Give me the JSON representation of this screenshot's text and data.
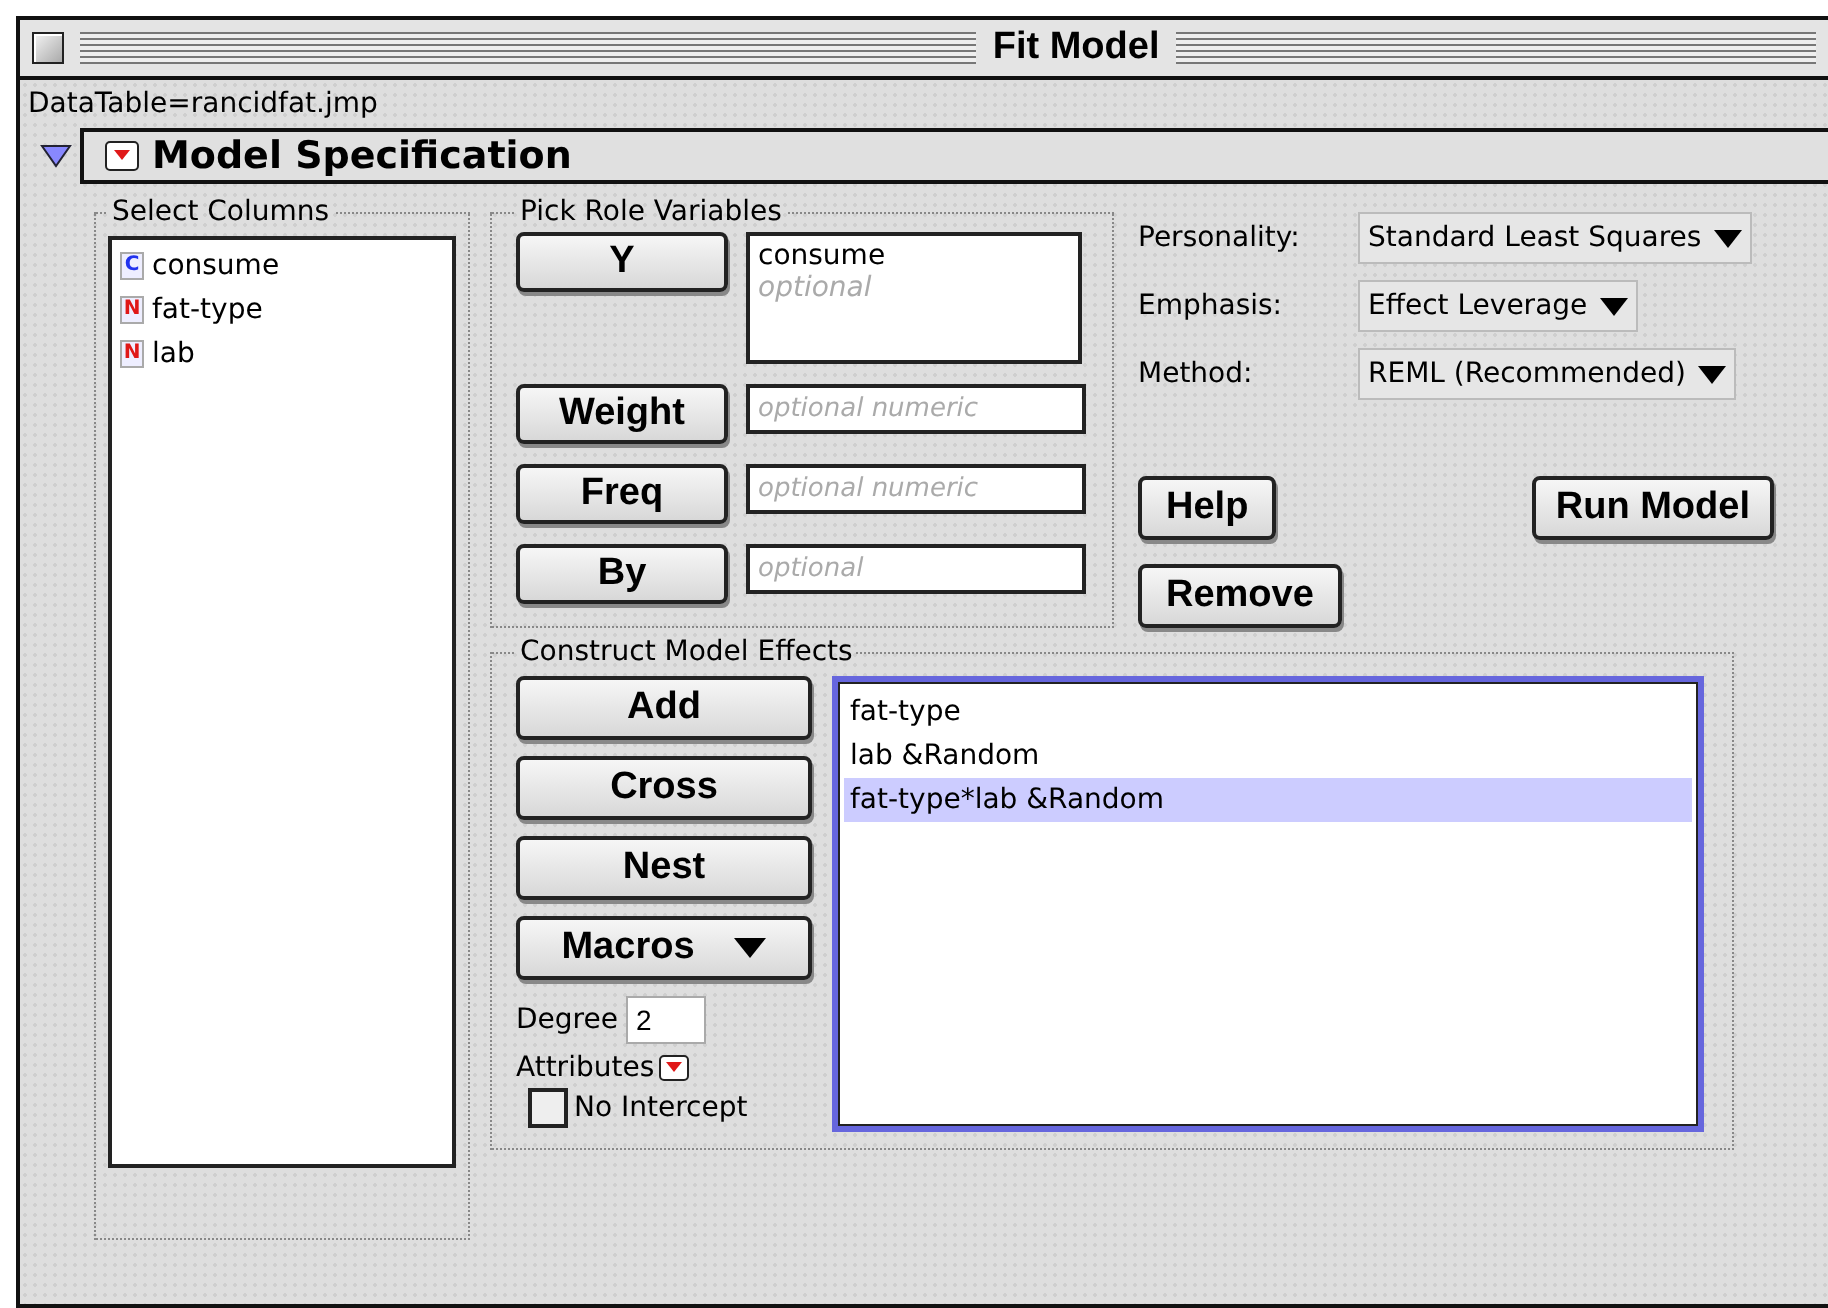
{
  "window": {
    "title": "Fit Model"
  },
  "data_table": "DataTable=rancidfat.jmp",
  "section": {
    "title": "Model Specification",
    "expanded": true
  },
  "select_columns": {
    "title": "Select Columns",
    "items": [
      {
        "name": "consume",
        "badge": "C",
        "kind": "continuous"
      },
      {
        "name": "fat-type",
        "badge": "N",
        "kind": "nominal"
      },
      {
        "name": "lab",
        "badge": "N",
        "kind": "nominal"
      }
    ]
  },
  "pick_roles": {
    "title": "Pick Role Variables",
    "roles": [
      {
        "button": "Y",
        "kind": "list",
        "values": [
          "consume"
        ],
        "placeholder": "optional"
      },
      {
        "button": "Weight",
        "kind": "field",
        "placeholder": "optional numeric"
      },
      {
        "button": "Freq",
        "kind": "field",
        "placeholder": "optional numeric"
      },
      {
        "button": "By",
        "kind": "field",
        "placeholder": "optional"
      }
    ]
  },
  "settings": [
    {
      "label": "Personality:",
      "value": "Standard Least Squares"
    },
    {
      "label": "Emphasis:",
      "value": "Effect Leverage"
    },
    {
      "label": "Method:",
      "value": "REML (Recommended)"
    }
  ],
  "action_buttons": [
    "Help",
    "Run Model",
    "Remove"
  ],
  "construct_effects": {
    "title": "Construct Model Effects",
    "buttons": [
      {
        "label": "Add",
        "kind": "plain"
      },
      {
        "label": "Cross",
        "kind": "plain"
      },
      {
        "label": "Nest",
        "kind": "plain"
      },
      {
        "label": "Macros",
        "kind": "menu"
      }
    ],
    "degree_label": "Degree",
    "degree": "2",
    "attributes_label": "Attributes",
    "no_intercept": {
      "label": "No Intercept",
      "checked": false
    },
    "effects": [
      {
        "text": "fat-type",
        "selected": false
      },
      {
        "text": "lab &Random",
        "selected": false
      },
      {
        "text": "fat-type*lab &Random",
        "selected": true
      }
    ]
  }
}
